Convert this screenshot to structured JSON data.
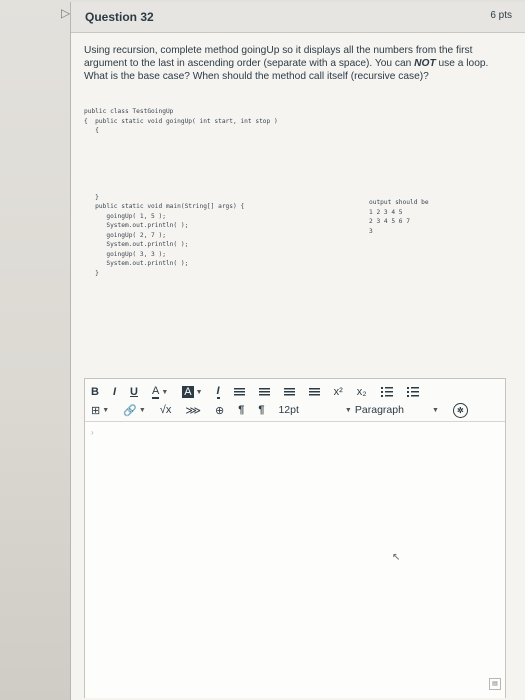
{
  "question": {
    "title": "Question 32",
    "points": "6 pts",
    "prompt_a": "Using recursion, complete method goingUp so it displays all the numbers from the first argument to the last in ascending order (separate with a space). You can ",
    "prompt_not": "NOT",
    "prompt_b": " use a loop. What is the base case? When should the method call itself (recursive case)?"
  },
  "code": {
    "lines": [
      "public class TestGoingUp",
      "{  public static void goingUp( int start, int stop )",
      "   {",
      "",
      "",
      "",
      "",
      "",
      "",
      "   }",
      "   public static void main(String[] args) {",
      "      goingUp( 1, 5 );",
      "      System.out.println( );",
      "      goingUp( 2, 7 );",
      "      System.out.println( );",
      "      goingUp( 3, 3 );",
      "      System.out.println( );",
      "   }"
    ],
    "output_lines": [
      "output should be",
      "1 2 3 4 5",
      "2 3 4 5 6 7",
      "3"
    ]
  },
  "toolbar": {
    "bold": "B",
    "italic": "I",
    "underline": "U",
    "font_color": "A",
    "highlight": "A",
    "clear_format": "I",
    "superscript": "x²",
    "subscript": "x₂",
    "insert": "⊞",
    "link": "🔗",
    "math": "√x",
    "embed": "⋙",
    "media": "⊕",
    "ltr": "¶",
    "rtl": "¶",
    "font_size": "12pt",
    "paragraph": "Paragraph",
    "a11y": "✲"
  },
  "editor": {
    "pointer": "↖",
    "resize": "▤"
  }
}
